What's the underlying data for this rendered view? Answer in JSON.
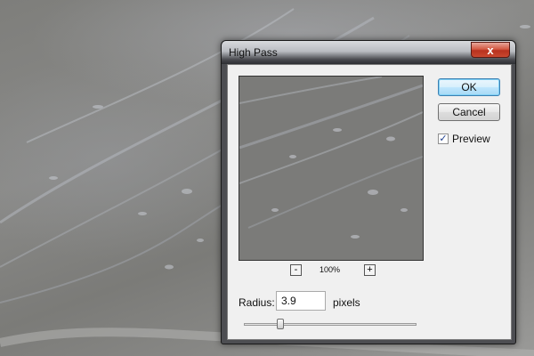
{
  "dialog": {
    "title": "High Pass",
    "close_label": "x",
    "ok_label": "OK",
    "cancel_label": "Cancel",
    "preview_label": "Preview",
    "preview_checked": true,
    "zoom_out_label": "-",
    "zoom_in_label": "+",
    "zoom_level": "100%",
    "radius_label": "Radius:",
    "radius_value": "3.9",
    "radius_units": "pixels",
    "radius_slider_fraction": 0.21
  },
  "colors": {
    "canvas_gray": "#7f7f7d",
    "window_frame": "#4d4e52",
    "close_red": "#c9482f",
    "ok_blue": "#3c7fb1"
  }
}
